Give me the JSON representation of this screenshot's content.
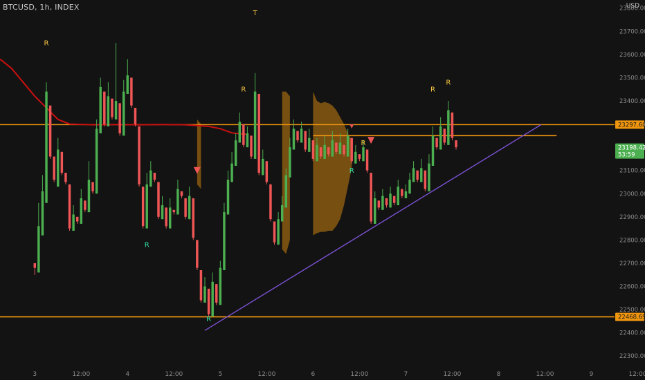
{
  "header": {
    "ticker": "BTCUSD, 1h, INDEX",
    "currency": "USD"
  },
  "colors": {
    "background": "#131313",
    "bull": "#4caf50",
    "bear": "#f05656",
    "signal_bull": "#2ee6a8",
    "signal_bear": "#f5c542",
    "ma": "#cc1010",
    "level": "#f0960e",
    "trend": "#7c52d6",
    "band": "#8a5a12",
    "axis_text": "#8a8a8a",
    "label_text": "#ffffff"
  },
  "chart_data": {
    "type": "candlestick",
    "x_ticks": [
      "3",
      "12:00",
      "4",
      "12:00",
      "5",
      "12:00",
      "6",
      "12:00",
      "7",
      "12:00",
      "8",
      "12:00",
      "9",
      "12:00"
    ],
    "y_ticks": [
      23800,
      23700,
      23600,
      23500,
      23400,
      23300,
      23200,
      23100,
      23000,
      22900,
      22800,
      22700,
      22600,
      22500,
      22400,
      22300
    ],
    "ylim": [
      22250,
      23835
    ],
    "x_range_hours": [
      -9,
      150
    ],
    "price_labels": [
      {
        "value": 23297.6,
        "text": "23297.60"
      },
      {
        "value": 22468.69,
        "text": "22468.69"
      },
      {
        "value": 23198.42,
        "text": "23198.42",
        "sub": "53:59"
      }
    ],
    "horizontal_levels": [
      {
        "value": 23297.6,
        "from_hour": -9
      },
      {
        "value": 22468.69,
        "from_hour": -9
      },
      {
        "value": 23250,
        "from_hour": 72,
        "to_hour": 135
      }
    ],
    "trendline": {
      "start": {
        "hour": 44,
        "price": 22410
      },
      "end": {
        "hour": 131,
        "price": 23297.6
      }
    },
    "moving_average": [
      [
        -9,
        23580
      ],
      [
        -6,
        23540
      ],
      [
        -3,
        23480
      ],
      [
        0,
        23420
      ],
      [
        3,
        23370
      ],
      [
        6,
        23320
      ],
      [
        9,
        23300
      ],
      [
        15,
        23297
      ],
      [
        21,
        23298
      ],
      [
        27,
        23297
      ],
      [
        33,
        23298
      ],
      [
        39,
        23297
      ],
      [
        45,
        23290
      ],
      [
        48,
        23280
      ],
      [
        51,
        23262
      ],
      [
        55,
        23255
      ]
    ],
    "bands": [
      {
        "start_hour": 42,
        "end_hour": 43,
        "upper": [
          [
            42,
            23320
          ],
          [
            43,
            23300
          ]
        ],
        "lower": [
          [
            42,
            23040
          ],
          [
            43,
            23020
          ]
        ]
      },
      {
        "start_hour": 64,
        "end_hour": 66,
        "upper": [
          [
            64,
            23440
          ],
          [
            65,
            23440
          ],
          [
            66,
            23420
          ]
        ],
        "lower": [
          [
            64,
            22760
          ],
          [
            65,
            22740
          ],
          [
            66,
            22800
          ]
        ]
      },
      {
        "start_hour": 72,
        "end_hour": 82,
        "upper": [
          [
            72,
            23440
          ],
          [
            73,
            23400
          ],
          [
            74,
            23390
          ],
          [
            75,
            23395
          ],
          [
            76,
            23390
          ],
          [
            77,
            23380
          ],
          [
            78,
            23360
          ],
          [
            79,
            23330
          ],
          [
            80,
            23300
          ],
          [
            81,
            23260
          ],
          [
            82,
            23230
          ]
        ],
        "lower": [
          [
            72,
            22820
          ],
          [
            73,
            22830
          ],
          [
            74,
            22835
          ],
          [
            75,
            22835
          ],
          [
            76,
            22840
          ],
          [
            77,
            22840
          ],
          [
            78,
            22860
          ],
          [
            79,
            22890
          ],
          [
            80,
            22950
          ],
          [
            81,
            23030
          ],
          [
            82,
            23110
          ]
        ]
      }
    ],
    "signals": [
      {
        "hour": 3,
        "price": 23640,
        "text": "R",
        "kind": "bear"
      },
      {
        "hour": 29,
        "price": 22770,
        "text": "R",
        "kind": "bull"
      },
      {
        "hour": 57,
        "price": 23770,
        "text": "T",
        "kind": "bear"
      },
      {
        "hour": 54,
        "price": 23440,
        "text": "R",
        "kind": "bear"
      },
      {
        "hour": 45,
        "price": 22450,
        "text": "R",
        "kind": "bull"
      },
      {
        "hour": 82,
        "price": 23090,
        "text": "R",
        "kind": "bull"
      },
      {
        "hour": 85,
        "price": 23210,
        "text": "R",
        "kind": "bear"
      },
      {
        "hour": 103,
        "price": 23440,
        "text": "R",
        "kind": "bear"
      },
      {
        "hour": 107,
        "price": 23470,
        "text": "R",
        "kind": "bear"
      }
    ],
    "triangles": [
      {
        "hour": 42,
        "price": 23100,
        "size": "normal"
      },
      {
        "hour": 82,
        "price": 23290,
        "size": "small"
      },
      {
        "hour": 87,
        "price": 23230,
        "size": "normal"
      }
    ],
    "candles": [
      [
        22700,
        22680,
        22650,
        22630
      ],
      [
        22660,
        22860,
        22840,
        22960
      ],
      [
        22820,
        23010,
        22980,
        23080
      ],
      [
        22960,
        23440,
        23400,
        23480
      ],
      [
        23380,
        23160,
        23150,
        23120
      ],
      [
        23160,
        23060,
        23050,
        23030
      ],
      [
        23030,
        23190,
        23180,
        23240
      ],
      [
        23180,
        23090,
        23080,
        23040
      ],
      [
        23090,
        23050,
        23040,
        22980
      ],
      [
        23040,
        22850,
        22840,
        22790
      ],
      [
        22840,
        22910,
        22900,
        22950
      ],
      [
        22900,
        22880,
        22870,
        22840
      ],
      [
        22870,
        22980,
        22970,
        23020
      ],
      [
        22970,
        22930,
        22920,
        22880
      ],
      [
        22920,
        23060,
        23050,
        23140
      ],
      [
        23050,
        23010,
        23000,
        22950
      ],
      [
        23000,
        23280,
        23260,
        23320
      ],
      [
        23260,
        23460,
        23440,
        23500
      ],
      [
        23440,
        23300,
        23290,
        23260
      ],
      [
        23290,
        23420,
        23410,
        23480
      ],
      [
        23410,
        23330,
        23320,
        23290
      ],
      [
        23320,
        23400,
        23390,
        23650
      ],
      [
        23390,
        23260,
        23250,
        23210
      ],
      [
        23250,
        23440,
        23430,
        23490
      ],
      [
        23430,
        23510,
        23500,
        23580
      ],
      [
        23500,
        23380,
        23370,
        23340
      ],
      [
        23370,
        23300,
        23290,
        23250
      ],
      [
        23290,
        23040,
        23030,
        22980
      ],
      [
        23030,
        22860,
        22850,
        22820
      ],
      [
        22850,
        23040,
        23030,
        23090
      ],
      [
        23030,
        23100,
        23090,
        23140
      ],
      [
        23090,
        23060,
        23050,
        23010
      ],
      [
        23050,
        22900,
        22890,
        22850
      ],
      [
        22890,
        22950,
        22940,
        22990
      ],
      [
        22940,
        22860,
        22850,
        22820
      ],
      [
        22850,
        22940,
        22930,
        22980
      ],
      [
        22930,
        22920,
        22910,
        22870
      ],
      [
        22910,
        23020,
        23010,
        23060
      ],
      [
        23010,
        22990,
        22980,
        22950
      ],
      [
        22980,
        22900,
        22890,
        22860
      ],
      [
        22890,
        22990,
        22980,
        23030
      ],
      [
        22980,
        22810,
        22800,
        22760
      ],
      [
        22800,
        22680,
        22670,
        22620
      ],
      [
        22670,
        22540,
        22530,
        22500
      ],
      [
        22530,
        22600,
        22590,
        22640
      ],
      [
        22590,
        22480,
        22470,
        22440
      ],
      [
        22470,
        22620,
        22610,
        22660
      ],
      [
        22610,
        22530,
        22520,
        22490
      ],
      [
        22520,
        22680,
        22670,
        22710
      ],
      [
        22670,
        22920,
        22910,
        22960
      ],
      [
        22910,
        23060,
        23050,
        23100
      ],
      [
        23050,
        23130,
        23120,
        23180
      ],
      [
        23120,
        23230,
        23220,
        23260
      ],
      [
        23220,
        23310,
        23300,
        23350
      ],
      [
        23300,
        23210,
        23200,
        23170
      ],
      [
        23200,
        23260,
        23250,
        23290
      ],
      [
        23250,
        23160,
        23150,
        23120
      ],
      [
        23150,
        23440,
        23430,
        23520
      ],
      [
        23430,
        23090,
        23080,
        23040
      ],
      [
        23080,
        23150,
        23140,
        23190
      ],
      [
        23140,
        23050,
        23040,
        23000
      ],
      [
        23040,
        22890,
        22880,
        22840
      ],
      [
        22880,
        22790,
        22780,
        22750
      ],
      [
        22780,
        22890,
        22880,
        22920
      ],
      [
        22880,
        22950,
        22940,
        22990
      ],
      [
        22940,
        23080,
        23070,
        23110
      ],
      [
        23070,
        23200,
        23190,
        23240
      ],
      [
        23190,
        23280,
        23270,
        23320
      ],
      [
        23270,
        23230,
        23220,
        23190
      ],
      [
        23220,
        23280,
        23270,
        23310
      ],
      [
        23270,
        23190,
        23180,
        23150
      ],
      [
        23180,
        23240,
        23230,
        23280
      ],
      [
        23230,
        23150,
        23140,
        23110
      ],
      [
        23140,
        23210,
        23200,
        23240
      ],
      [
        23200,
        23160,
        23150,
        23120
      ],
      [
        23150,
        23210,
        23200,
        23250
      ],
      [
        23200,
        23170,
        23160,
        23130
      ],
      [
        23160,
        23230,
        23220,
        23270
      ],
      [
        23220,
        23180,
        23170,
        23140
      ],
      [
        23170,
        23220,
        23210,
        23260
      ],
      [
        23210,
        23170,
        23160,
        23120
      ],
      [
        23160,
        23250,
        23240,
        23280
      ],
      [
        23240,
        23140,
        23130,
        23080
      ],
      [
        23130,
        23180,
        23170,
        23210
      ],
      [
        23170,
        23150,
        23140,
        23110
      ],
      [
        23140,
        23200,
        23190,
        23230
      ],
      [
        23190,
        23100,
        23090,
        23060
      ],
      [
        23090,
        22880,
        22870,
        22830
      ],
      [
        22870,
        22980,
        22970,
        23010
      ],
      [
        22970,
        22940,
        22930,
        22890
      ],
      [
        22930,
        22990,
        22980,
        23020
      ],
      [
        22980,
        22950,
        22940,
        22910
      ],
      [
        22940,
        23000,
        22990,
        23030
      ],
      [
        22990,
        22960,
        22950,
        22920
      ],
      [
        22950,
        23030,
        23020,
        23060
      ],
      [
        23020,
        22990,
        22980,
        22950
      ],
      [
        22980,
        23010,
        23000,
        23040
      ],
      [
        23000,
        23060,
        23050,
        23090
      ],
      [
        23050,
        23110,
        23100,
        23140
      ],
      [
        23100,
        23060,
        23050,
        23020
      ],
      [
        23050,
        23110,
        23100,
        23150
      ],
      [
        23100,
        23020,
        23010,
        22980
      ],
      [
        23010,
        23130,
        23120,
        23170
      ],
      [
        23120,
        23250,
        23240,
        23290
      ],
      [
        23240,
        23200,
        23190,
        23160
      ],
      [
        23190,
        23290,
        23280,
        23330
      ],
      [
        23280,
        23220,
        23210,
        23180
      ],
      [
        23210,
        23360,
        23350,
        23400
      ],
      [
        23350,
        23240,
        23230,
        23190
      ],
      [
        23230,
        23200,
        23190,
        23160
      ]
    ]
  }
}
